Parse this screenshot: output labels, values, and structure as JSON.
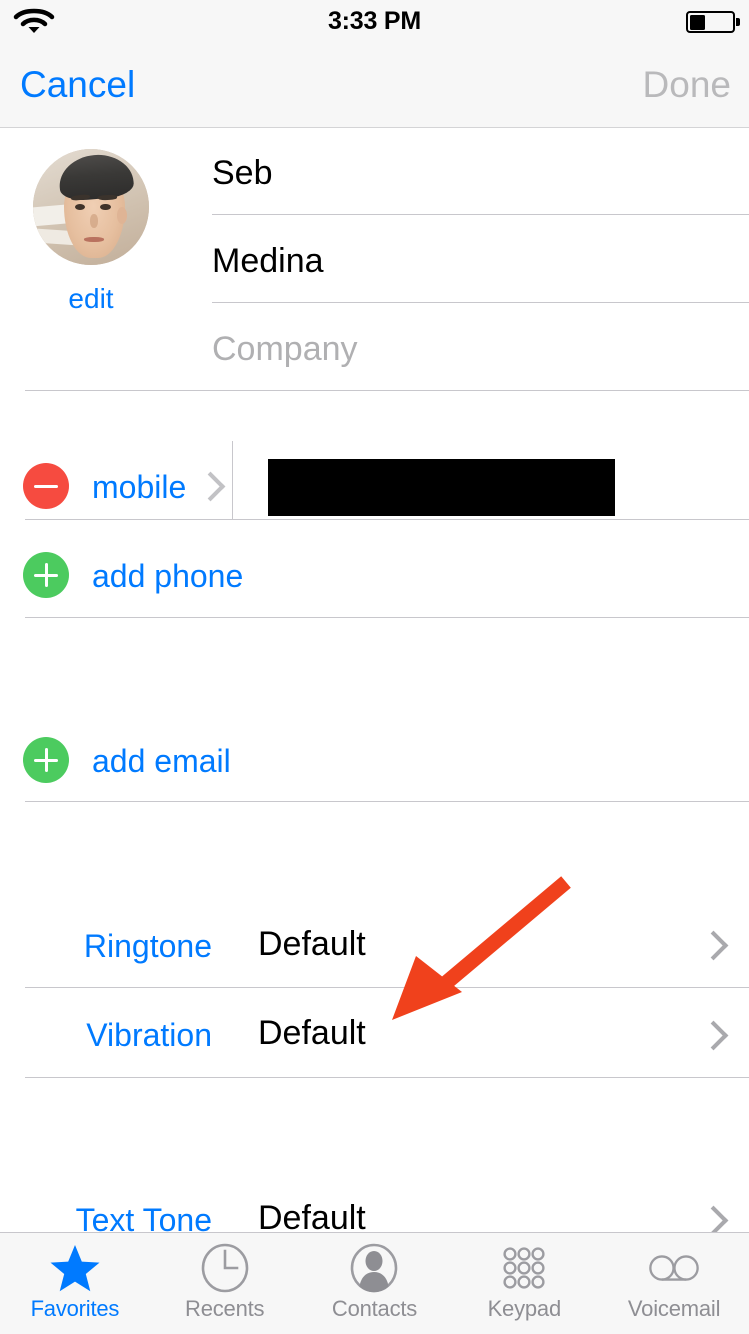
{
  "status_bar": {
    "time": "3:33 PM",
    "wifi_icon": "wifi-icon",
    "battery_icon": "battery-icon",
    "battery_level_percent": 38
  },
  "nav_bar": {
    "cancel_label": "Cancel",
    "done_label": "Done",
    "done_enabled": false
  },
  "contact": {
    "avatar_edit_label": "edit",
    "first_name": "Seb",
    "last_name": "Medina",
    "company_placeholder": "Company",
    "phone": {
      "remove_label": "remove",
      "type_label": "mobile",
      "number_redacted": true,
      "number": ""
    },
    "add_phone_label": "add phone",
    "add_email_label": "add email"
  },
  "settings_rows": [
    {
      "label": "Ringtone",
      "value": "Default"
    },
    {
      "label": "Vibration",
      "value": "Default"
    },
    {
      "label": "Text Tone",
      "value": "Default"
    }
  ],
  "annotation": {
    "arrow_color": "#f0411c",
    "points_to": "Vibration"
  },
  "colors": {
    "accent_blue": "#007aff",
    "disabled_gray": "#b9b9bb",
    "delete_red": "#f64b40",
    "add_green": "#4ccb5f",
    "separator": "#c8c7cc",
    "bar_background": "#f7f7f7"
  },
  "tab_bar": {
    "tabs": [
      {
        "label": "Favorites",
        "icon": "star-icon",
        "active": true
      },
      {
        "label": "Recents",
        "icon": "clock-icon",
        "active": false
      },
      {
        "label": "Contacts",
        "icon": "person-icon",
        "active": false
      },
      {
        "label": "Keypad",
        "icon": "keypad-icon",
        "active": false
      },
      {
        "label": "Voicemail",
        "icon": "voicemail-icon",
        "active": false
      }
    ]
  }
}
